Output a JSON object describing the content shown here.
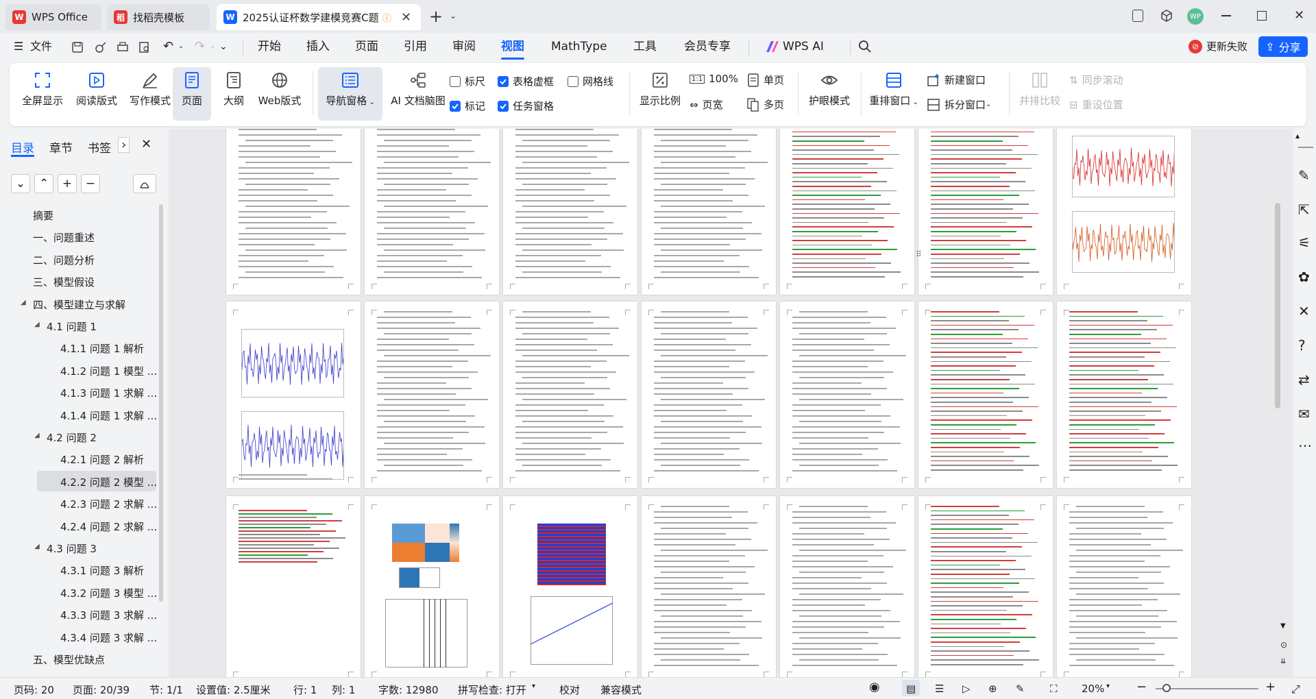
{
  "tabs": [
    {
      "label": "WPS Office"
    },
    {
      "label": "找稻壳模板"
    },
    {
      "label": "2025认证杯数学建模竞赛C题"
    }
  ],
  "window": {
    "avatar": "WP"
  },
  "menu": {
    "file": "文件",
    "items": [
      "开始",
      "插入",
      "页面",
      "引用",
      "审阅",
      "视图",
      "MathType",
      "工具",
      "会员专享"
    ],
    "active": "视图",
    "wps_ai": "WPS AI",
    "update_failed": "更新失败",
    "share": "分享"
  },
  "ribbon": {
    "fullscreen": "全屏显示",
    "reading": "阅读版式",
    "writing": "写作模式",
    "page": "页面",
    "outline": "大纲",
    "web": "Web版式",
    "nav_pane": "导航窗格",
    "ai_map": "AI 文档脑图",
    "ruler": "标尺",
    "table_grid": "表格虚框",
    "gridlines": "网格线",
    "marks": "标记",
    "task_pane": "任务窗格",
    "zoom": "显示比例",
    "zoom_100": "100%",
    "page_width": "页宽",
    "single_page": "单页",
    "multi_page": "多页",
    "eye_mode": "护眼模式",
    "rearrange": "重排窗口",
    "new_window": "新建窗口",
    "split_window": "拆分窗口",
    "side_by_side": "并排比较",
    "sync_scroll": "同步滚动",
    "reset_pos": "重设位置",
    "checks": {
      "ruler": false,
      "table_grid": true,
      "gridlines": false,
      "marks": true,
      "task_pane": true
    }
  },
  "nav": {
    "tabs": [
      "目录",
      "章节",
      "书签"
    ],
    "toc": [
      {
        "label": "摘要",
        "level": 1
      },
      {
        "label": "一、问题重述",
        "level": 1
      },
      {
        "label": "二、问题分析",
        "level": 1
      },
      {
        "label": "三、模型假设",
        "level": 1
      },
      {
        "label": "四、模型建立与求解",
        "level": 1
      },
      {
        "label": "4.1 问题 1",
        "level": 2
      },
      {
        "label": "4.1.1 问题 1 解析",
        "level": 3
      },
      {
        "label": "4.1.2 问题 1 模型 ...",
        "level": 3
      },
      {
        "label": "4.1.3 问题 1 求解 ...",
        "level": 3
      },
      {
        "label": "4.1.4 问题 1 求解 ...",
        "level": 3
      },
      {
        "label": "4.2 问题 2",
        "level": 2
      },
      {
        "label": "4.2.1 问题 2 解析",
        "level": 3
      },
      {
        "label": "4.2.2 问题 2 模型 ...",
        "level": 3,
        "selected": true
      },
      {
        "label": "4.2.3 问题 2 求解 ...",
        "level": 3
      },
      {
        "label": "4.2.4 问题 2 求解 ...",
        "level": 3
      },
      {
        "label": "4.3 问题 3",
        "level": 2
      },
      {
        "label": "4.3.1 问题 3 解析",
        "level": 3
      },
      {
        "label": "4.3.2 问题 3 模型 ...",
        "level": 3
      },
      {
        "label": "4.3.3 问题 3 求解 ...",
        "level": 3
      },
      {
        "label": "4.3.4 问题 3 求解 ...",
        "level": 3
      },
      {
        "label": "五、模型优缺点",
        "level": 1
      }
    ]
  },
  "status": {
    "page_no": "页码: 20",
    "pages": "页面: 20/39",
    "section": "节: 1/1",
    "setting": "设置值: 2.5厘米",
    "row": "行: 1",
    "col": "列: 1",
    "words": "字数: 12980",
    "spell": "拼写检查: 打开",
    "proof": "校对",
    "compat": "兼容模式",
    "zoom": "20%"
  },
  "colors": {
    "accent": "#1664ff",
    "tab_active": "#ffffff",
    "chart_red": "#d62728",
    "chart_blue": "#3a3ac9"
  }
}
